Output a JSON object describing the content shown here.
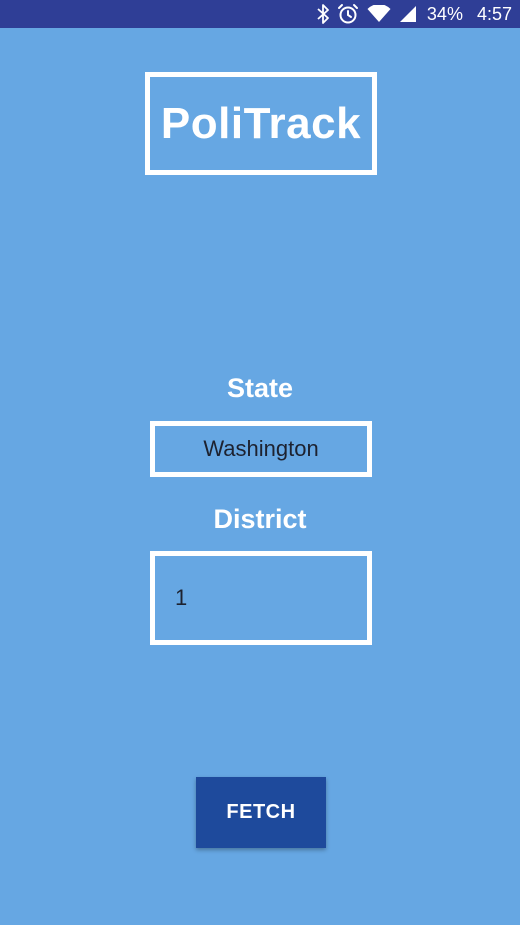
{
  "status_bar": {
    "battery": "34%",
    "time": "4:57",
    "icons": [
      "bluetooth-icon",
      "alarm-icon",
      "wifi-icon",
      "signal-icon"
    ]
  },
  "app": {
    "title": "PoliTrack"
  },
  "form": {
    "state_label": "State",
    "state_value": "Washington",
    "district_label": "District",
    "district_value": "1",
    "fetch_label": "FETCH"
  },
  "colors": {
    "background": "#66a7e3",
    "status_bar": "#2f3e96",
    "button": "#1e4a9c",
    "border": "#ffffff",
    "input_text": "#1d2230"
  }
}
